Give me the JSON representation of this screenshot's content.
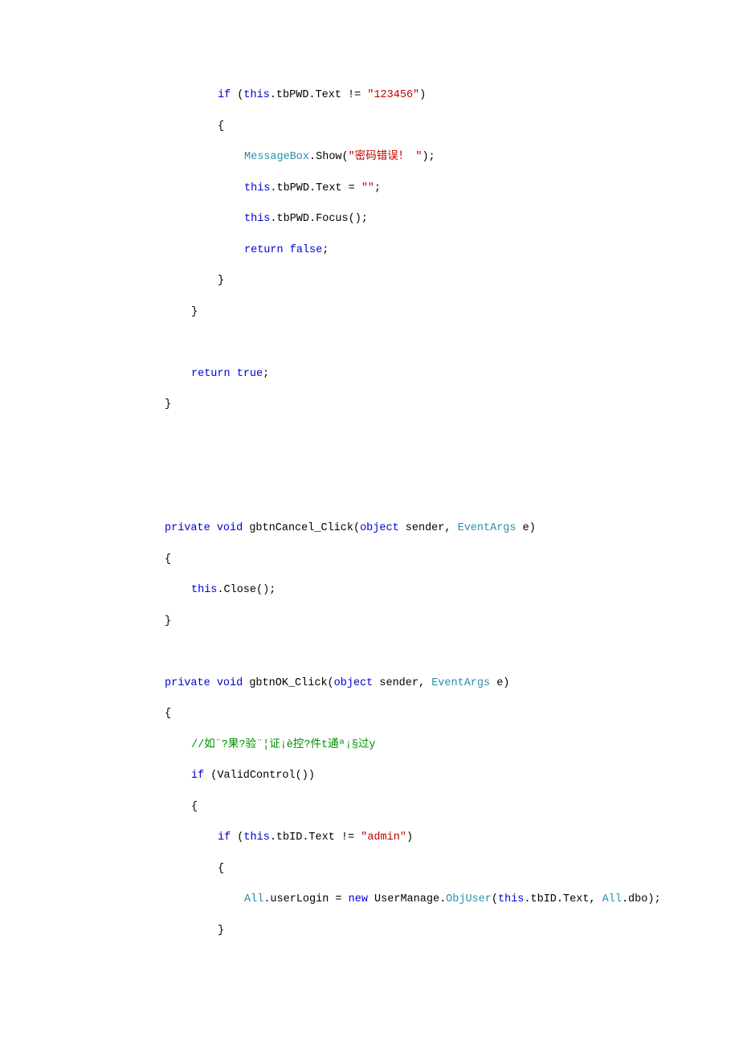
{
  "lines": [
    {
      "indent": "indent2",
      "segments": [
        {
          "cls": "kw",
          "t": "if"
        },
        {
          "cls": "plain",
          "t": " ("
        },
        {
          "cls": "kw",
          "t": "this"
        },
        {
          "cls": "plain",
          "t": ".tbPWD.Text != "
        },
        {
          "cls": "str",
          "t": "\"123456\""
        },
        {
          "cls": "plain",
          "t": ")"
        }
      ]
    },
    {
      "indent": "indent2",
      "segments": [
        {
          "cls": "plain",
          "t": "{"
        }
      ]
    },
    {
      "indent": "indent3",
      "segments": [
        {
          "cls": "type",
          "t": "MessageBox"
        },
        {
          "cls": "plain",
          "t": ".Show("
        },
        {
          "cls": "str",
          "t": "\"密码错误！ \""
        },
        {
          "cls": "plain",
          "t": ");"
        }
      ]
    },
    {
      "indent": "indent3",
      "segments": [
        {
          "cls": "kw",
          "t": "this"
        },
        {
          "cls": "plain",
          "t": ".tbPWD.Text = "
        },
        {
          "cls": "str",
          "t": "\"\""
        },
        {
          "cls": "plain",
          "t": ";"
        }
      ]
    },
    {
      "indent": "indent3",
      "segments": [
        {
          "cls": "kw",
          "t": "this"
        },
        {
          "cls": "plain",
          "t": ".tbPWD.Focus();"
        }
      ]
    },
    {
      "indent": "indent3",
      "segments": [
        {
          "cls": "kw",
          "t": "return"
        },
        {
          "cls": "plain",
          "t": " "
        },
        {
          "cls": "kw",
          "t": "false"
        },
        {
          "cls": "plain",
          "t": ";"
        }
      ]
    },
    {
      "indent": "indent2",
      "segments": [
        {
          "cls": "plain",
          "t": "}"
        }
      ]
    },
    {
      "indent": "indent1",
      "segments": [
        {
          "cls": "plain",
          "t": "}"
        }
      ]
    },
    {
      "indent": "indent1",
      "segments": [
        {
          "cls": "plain",
          "t": ""
        }
      ]
    },
    {
      "indent": "indent1",
      "segments": [
        {
          "cls": "kw",
          "t": "return"
        },
        {
          "cls": "plain",
          "t": " "
        },
        {
          "cls": "kw",
          "t": "true"
        },
        {
          "cls": "plain",
          "t": ";"
        }
      ]
    },
    {
      "indent": "indent0",
      "segments": [
        {
          "cls": "plain",
          "t": "}"
        }
      ]
    },
    {
      "indent": "indent0",
      "segments": [
        {
          "cls": "plain",
          "t": ""
        }
      ]
    },
    {
      "indent": "indent0",
      "segments": [
        {
          "cls": "plain",
          "t": ""
        }
      ]
    },
    {
      "indent": "indent0",
      "segments": [
        {
          "cls": "plain",
          "t": ""
        }
      ]
    },
    {
      "indent": "indent0",
      "segments": [
        {
          "cls": "kw",
          "t": "private"
        },
        {
          "cls": "plain",
          "t": " "
        },
        {
          "cls": "kw",
          "t": "void"
        },
        {
          "cls": "plain",
          "t": " gbtnCancel_Click("
        },
        {
          "cls": "kw",
          "t": "object"
        },
        {
          "cls": "plain",
          "t": " sender, "
        },
        {
          "cls": "type",
          "t": "EventArgs"
        },
        {
          "cls": "plain",
          "t": " e)"
        }
      ]
    },
    {
      "indent": "indent0",
      "segments": [
        {
          "cls": "plain",
          "t": "{"
        }
      ]
    },
    {
      "indent": "indent1",
      "segments": [
        {
          "cls": "kw",
          "t": "this"
        },
        {
          "cls": "plain",
          "t": ".Close();"
        }
      ]
    },
    {
      "indent": "indent0",
      "segments": [
        {
          "cls": "plain",
          "t": "}"
        }
      ]
    },
    {
      "indent": "indent0",
      "segments": [
        {
          "cls": "plain",
          "t": ""
        }
      ]
    },
    {
      "indent": "indent0",
      "segments": [
        {
          "cls": "kw",
          "t": "private"
        },
        {
          "cls": "plain",
          "t": " "
        },
        {
          "cls": "kw",
          "t": "void"
        },
        {
          "cls": "plain",
          "t": " gbtnOK_Click("
        },
        {
          "cls": "kw",
          "t": "object"
        },
        {
          "cls": "plain",
          "t": " sender, "
        },
        {
          "cls": "type",
          "t": "EventArgs"
        },
        {
          "cls": "plain",
          "t": " e)"
        }
      ]
    },
    {
      "indent": "indent0",
      "segments": [
        {
          "cls": "plain",
          "t": "{"
        }
      ]
    },
    {
      "indent": "indent1",
      "segments": [
        {
          "cls": "comment",
          "t": "//如¨?果?验¨¦证¡è控?件t通ª¡§过y"
        }
      ]
    },
    {
      "indent": "indent1",
      "segments": [
        {
          "cls": "kw",
          "t": "if"
        },
        {
          "cls": "plain",
          "t": " (ValidControl())"
        }
      ]
    },
    {
      "indent": "indent1",
      "segments": [
        {
          "cls": "plain",
          "t": "{"
        }
      ]
    },
    {
      "indent": "indent2",
      "segments": [
        {
          "cls": "kw",
          "t": "if"
        },
        {
          "cls": "plain",
          "t": " ("
        },
        {
          "cls": "kw",
          "t": "this"
        },
        {
          "cls": "plain",
          "t": ".tbID.Text != "
        },
        {
          "cls": "str",
          "t": "\"admin\""
        },
        {
          "cls": "plain",
          "t": ")"
        }
      ]
    },
    {
      "indent": "indent2",
      "segments": [
        {
          "cls": "plain",
          "t": "{"
        }
      ]
    },
    {
      "indent": "indent3",
      "segments": [
        {
          "cls": "type",
          "t": "All"
        },
        {
          "cls": "plain",
          "t": ".userLogin = "
        },
        {
          "cls": "kw",
          "t": "new"
        },
        {
          "cls": "plain",
          "t": " UserManage."
        },
        {
          "cls": "type",
          "t": "ObjUser"
        },
        {
          "cls": "plain",
          "t": "("
        },
        {
          "cls": "kw",
          "t": "this"
        },
        {
          "cls": "plain",
          "t": ".tbID.Text, "
        },
        {
          "cls": "type",
          "t": "All"
        },
        {
          "cls": "plain",
          "t": ".dbo);"
        }
      ]
    },
    {
      "indent": "indent2",
      "segments": [
        {
          "cls": "plain",
          "t": "}"
        }
      ]
    }
  ]
}
